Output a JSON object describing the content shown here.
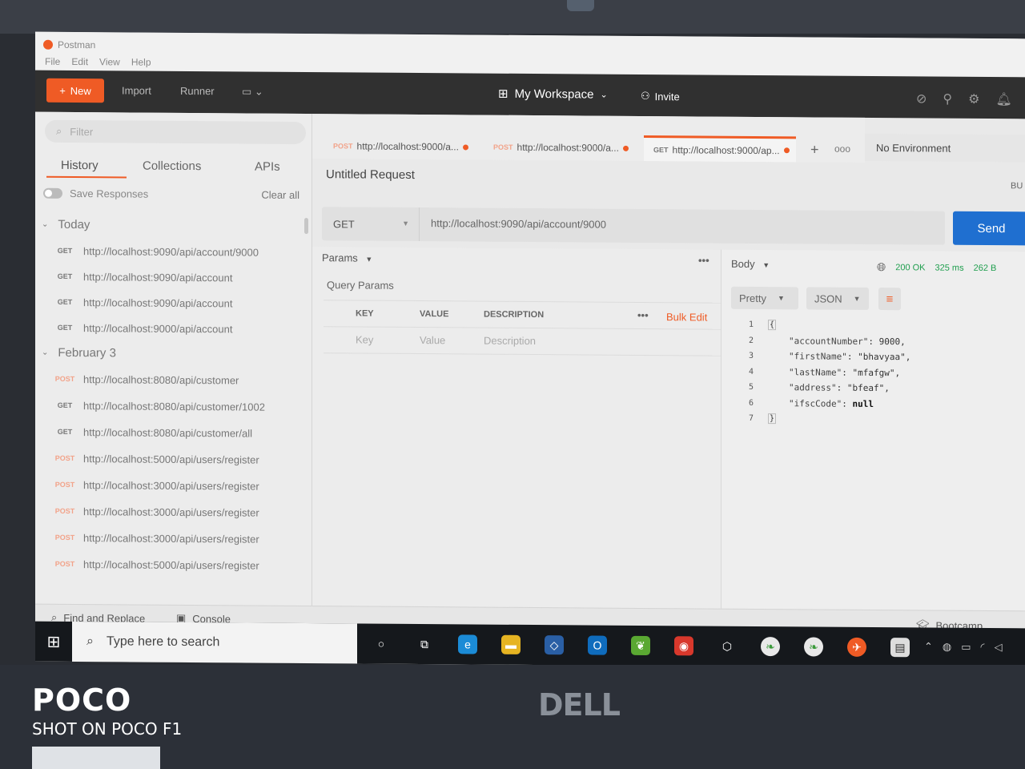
{
  "app": {
    "title": "Postman"
  },
  "menu": [
    "File",
    "Edit",
    "View",
    "Help"
  ],
  "header": {
    "new_label": "New",
    "import_label": "Import",
    "runner_label": "Runner",
    "workspace_label": "My Workspace",
    "invite_label": "Invite"
  },
  "sidebar": {
    "filter_placeholder": "Filter",
    "tabs": [
      "History",
      "Collections",
      "APIs"
    ],
    "save_responses": "Save Responses",
    "clear_all": "Clear all",
    "groups": [
      {
        "label": "Today",
        "items": [
          {
            "method": "GET",
            "url": "http://localhost:9090/api/account/9000"
          },
          {
            "method": "GET",
            "url": "http://localhost:9090/api/account"
          },
          {
            "method": "GET",
            "url": "http://localhost:9090/api/account"
          },
          {
            "method": "GET",
            "url": "http://localhost:9000/api/account"
          }
        ]
      },
      {
        "label": "February 3",
        "items": [
          {
            "method": "POST",
            "url": "http://localhost:8080/api/customer"
          },
          {
            "method": "GET",
            "url": "http://localhost:8080/api/customer/1002"
          },
          {
            "method": "GET",
            "url": "http://localhost:8080/api/customer/all"
          },
          {
            "method": "POST",
            "url": "http://localhost:5000/api/users/register"
          },
          {
            "method": "POST",
            "url": "http://localhost:3000/api/users/register"
          },
          {
            "method": "POST",
            "url": "http://localhost:3000/api/users/register"
          },
          {
            "method": "POST",
            "url": "http://localhost:3000/api/users/register"
          },
          {
            "method": "POST",
            "url": "http://localhost:5000/api/users/register"
          }
        ]
      }
    ]
  },
  "tabs": [
    {
      "method": "POST",
      "label": "http://localhost:9000/a..."
    },
    {
      "method": "POST",
      "label": "http://localhost:9000/a..."
    },
    {
      "method": "GET",
      "label": "http://localhost:9000/ap..."
    }
  ],
  "environment": "No Environment",
  "request": {
    "title": "Untitled Request",
    "bu": "BU",
    "method": "GET",
    "url": "http://localhost:9090/api/account/9000",
    "send_label": "Send",
    "params_label": "Params",
    "query_params_label": "Query Params",
    "columns": [
      "KEY",
      "VALUE",
      "DESCRIPTION"
    ],
    "placeholders": [
      "Key",
      "Value",
      "Description"
    ],
    "bulk_edit": "Bulk Edit"
  },
  "response": {
    "body_label": "Body",
    "status": "200 OK",
    "time": "325 ms",
    "size": "262 B",
    "format": "Pretty",
    "language": "JSON",
    "lines": [
      {
        "n": "1",
        "text": "{"
      },
      {
        "n": "2",
        "key": "\"accountNumber\"",
        "value": "9000,"
      },
      {
        "n": "3",
        "key": "\"firstName\"",
        "value": "\"bhavyaa\","
      },
      {
        "n": "4",
        "key": "\"lastName\"",
        "value": "\"mfafgw\","
      },
      {
        "n": "5",
        "key": "\"address\"",
        "value": "\"bfeaf\","
      },
      {
        "n": "6",
        "key": "\"ifscCode\"",
        "value": "null"
      },
      {
        "n": "7",
        "text": "}"
      }
    ]
  },
  "statusbar": {
    "find_replace": "Find and Replace",
    "console": "Console",
    "bootcamp": "Bootcamp"
  },
  "taskbar": {
    "search_placeholder": "Type here to search"
  },
  "watermark": {
    "brand": "POCO",
    "sub": "SHOT ON POCO F1"
  },
  "laptop_brand": "DELL",
  "colors": {
    "accent": "#ef5b25",
    "send": "#1f6fd0",
    "ok": "#1e9e4d"
  }
}
